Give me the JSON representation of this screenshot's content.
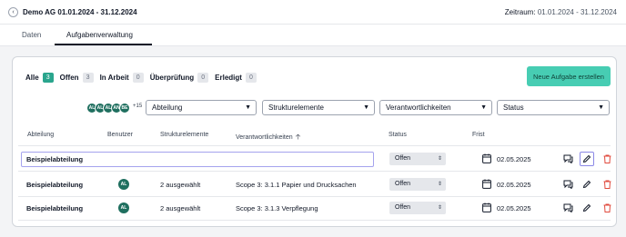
{
  "header": {
    "title": "Demo AG 01.01.2024 - 31.12.2024",
    "period_label": "Zeitraum:",
    "period_value": "01.01.2024 - 31.12.2024"
  },
  "tabs": [
    {
      "label": "Daten",
      "active": false
    },
    {
      "label": "Aufgabenverwaltung",
      "active": true
    }
  ],
  "filters": [
    {
      "label": "Alle",
      "count": "3",
      "active": true
    },
    {
      "label": "Offen",
      "count": "3",
      "active": false
    },
    {
      "label": "In Arbeit",
      "count": "0",
      "active": false
    },
    {
      "label": "Überprüfung",
      "count": "0",
      "active": false
    },
    {
      "label": "Erledigt",
      "count": "0",
      "active": false
    }
  ],
  "new_task_button": "Neue Aufgabe erstellen",
  "avatar_stack": {
    "initials": [
      "AL",
      "AL",
      "AL",
      "AN",
      "BE"
    ],
    "more": "+15"
  },
  "selects": {
    "abteilung": "Abteilung",
    "strukturelemente": "Strukturelemente",
    "verantwortlichkeiten": "Verantwortlichkeiten",
    "status": "Status"
  },
  "columns": {
    "abteilung": "Abteilung",
    "benutzer": "Benutzer",
    "strukturelemente": "Strukturelemente",
    "verantwortlichkeiten": "Verantwortlichkeiten",
    "status": "Status",
    "frist": "Frist"
  },
  "rows": [
    {
      "abteilung": "Beispielabteilung",
      "editing": true,
      "benutzer": "",
      "strukturelemente": "",
      "verantwortlichkeiten": "",
      "status": "Offen",
      "frist": "02.05.2025"
    },
    {
      "abteilung": "Beispielabteilung",
      "editing": false,
      "benutzer": "AL",
      "strukturelemente": "2 ausgewählt",
      "verantwortlichkeiten": "Scope 3: 3.1.1 Papier und Drucksachen",
      "status": "Offen",
      "frist": "02.05.2025"
    },
    {
      "abteilung": "Beispielabteilung",
      "editing": false,
      "benutzer": "AL",
      "strukturelemente": "2 ausgewählt",
      "verantwortlichkeiten": "Scope 3: 3.1.3 Verpflegung",
      "status": "Offen",
      "frist": "02.05.2025"
    }
  ],
  "colors": {
    "accent": "#47cdb3",
    "badge_active": "#2aa58d",
    "avatar": "#1f6f5f",
    "delete": "#e0493c"
  },
  "icons": {
    "back": "chevron-left-icon",
    "sort": "arrow-up-icon",
    "calendar": "calendar-icon",
    "comment": "comment-icon",
    "edit": "pencil-icon",
    "delete": "trash-icon"
  }
}
